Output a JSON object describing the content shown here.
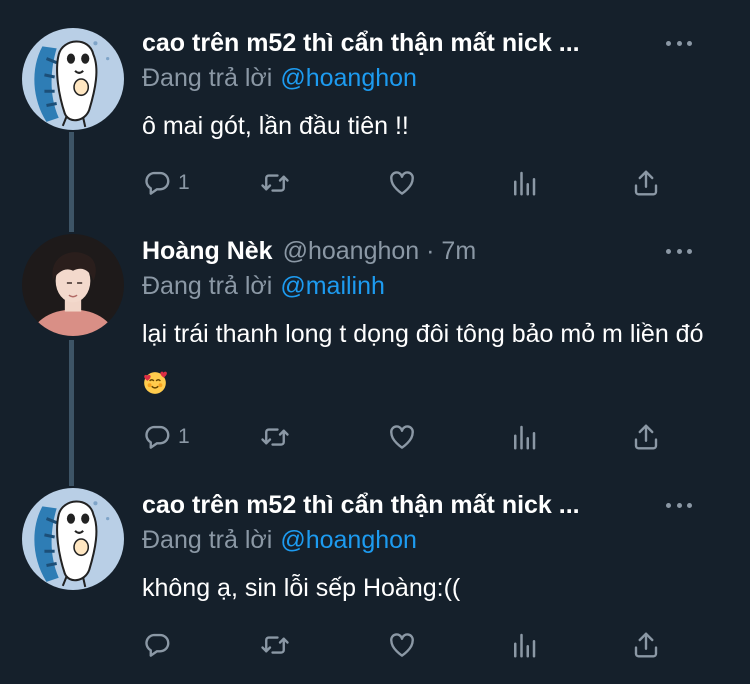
{
  "tweets": [
    {
      "name": "cao trên m52 thì cẩn thận mất nick ...",
      "handle": "",
      "replying_label": "Đang trả lời",
      "mention": "@hoanghon",
      "text": "ô mai gót, lần đầu tiên !!",
      "reply_count": "1",
      "avatar": "anime-character-avatar"
    },
    {
      "name": "Hoàng Nèk",
      "handle": "@hoanghon · 7m",
      "replying_label": "Đang trả lời",
      "mention": "@mailinh",
      "text": "lại trái thanh long t dọng đôi tông bảo mỏ m liền đó",
      "reply_count": "1",
      "avatar": "person-photo-avatar"
    },
    {
      "name": "cao trên m52 thì cẩn thận mất nick ...",
      "handle": "",
      "replying_label": "Đang trả lời",
      "mention": "@hoanghon",
      "text": "không ạ, sin lỗi sếp Hoàng:((",
      "reply_count": "",
      "avatar": "anime-character-avatar"
    }
  ],
  "icons": [
    "reply-icon",
    "retweet-icon",
    "like-icon",
    "views-icon",
    "share-icon",
    "more-icon",
    "smiling-hearts-emoji"
  ],
  "colors": {
    "background": "#15202b",
    "muted": "#8b98a5",
    "accent": "#1d9bf0",
    "thread_line": "#3d5466"
  }
}
